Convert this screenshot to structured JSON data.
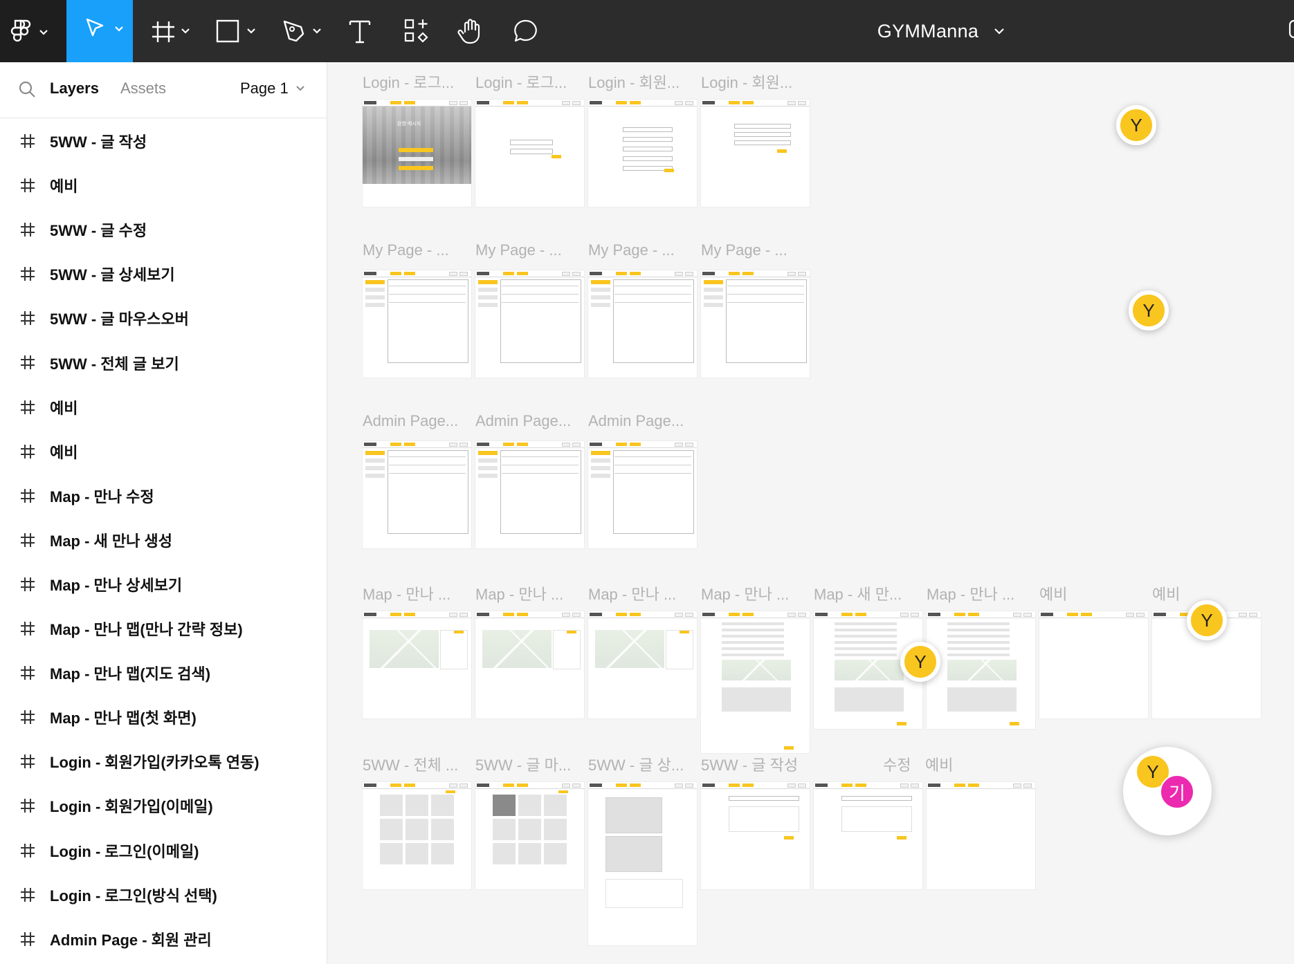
{
  "toolbar": {
    "file_title": "GYMManna",
    "tools": [
      {
        "name": "figma-menu",
        "icon": "figma-logo-icon"
      },
      {
        "name": "move",
        "icon": "cursor-arrow-icon",
        "active": true
      },
      {
        "name": "frame",
        "icon": "frame-hash-icon"
      },
      {
        "name": "shape",
        "icon": "rectangle-icon"
      },
      {
        "name": "pen",
        "icon": "pen-icon"
      },
      {
        "name": "text",
        "icon": "text-icon"
      },
      {
        "name": "resources",
        "icon": "components-icon"
      },
      {
        "name": "hand",
        "icon": "hand-icon"
      },
      {
        "name": "comment",
        "icon": "comment-bubble-icon"
      }
    ],
    "active_color": "#18a0fb"
  },
  "panel": {
    "tab_layers": "Layers",
    "tab_assets": "Assets",
    "page_selector": "Page 1",
    "layers": [
      "5WW - 글 작성",
      "예비",
      "5WW - 글 수정",
      "5WW - 글 상세보기",
      "5WW - 글 마우스오버",
      "5WW - 전체 글 보기",
      "예비",
      "예비",
      "Map - 만나 수정",
      "Map - 새 만나 생성",
      "Map - 만나 상세보기",
      "Map - 만나 맵(만나 간략 정보)",
      "Map - 만나 맵(지도 검색)",
      "Map - 만나 맵(첫 화면)",
      "Login - 회원가입(카카오톡 연동)",
      "Login - 회원가입(이메일)",
      "Login - 로그인(이메일)",
      "Login - 로그인(방식 선택)",
      "Admin Page - 회원 관리"
    ]
  },
  "canvas": {
    "frame_labels": {
      "row1": [
        "Login - 로그...",
        "Login - 로그...",
        "Login - 회원...",
        "Login - 회원..."
      ],
      "row2": [
        "My Page - ...",
        "My Page - ...",
        "My Page - ...",
        "My Page - ..."
      ],
      "row3": [
        "Admin Page...",
        "Admin Page...",
        "Admin Page..."
      ],
      "row4": [
        "Map - 만나 ...",
        "Map - 만나 ...",
        "Map - 만나 ...",
        "Map - 만나 ...",
        "Map - 새 만...",
        "Map - 만나 ...",
        "예비",
        "예비"
      ],
      "row5": [
        "5WW - 전체 ...",
        "5WW - 글 마...",
        "5WW - 글 상...",
        "5WW - 글 작성",
        "수정",
        "예비"
      ]
    },
    "collaborators": [
      {
        "initial": "Y",
        "color": "#f9c51f"
      },
      {
        "initial": "Y",
        "color": "#f9c51f"
      },
      {
        "initial": "Y",
        "color": "#f9c51f"
      },
      {
        "initial": "Y",
        "color": "#f9c51f"
      },
      {
        "initial": "Y",
        "color": "#f9c51f"
      },
      {
        "initial": "기",
        "color": "#ec2ab0"
      }
    ],
    "frame_text": {
      "login_welcome": "환영 메시지"
    }
  }
}
